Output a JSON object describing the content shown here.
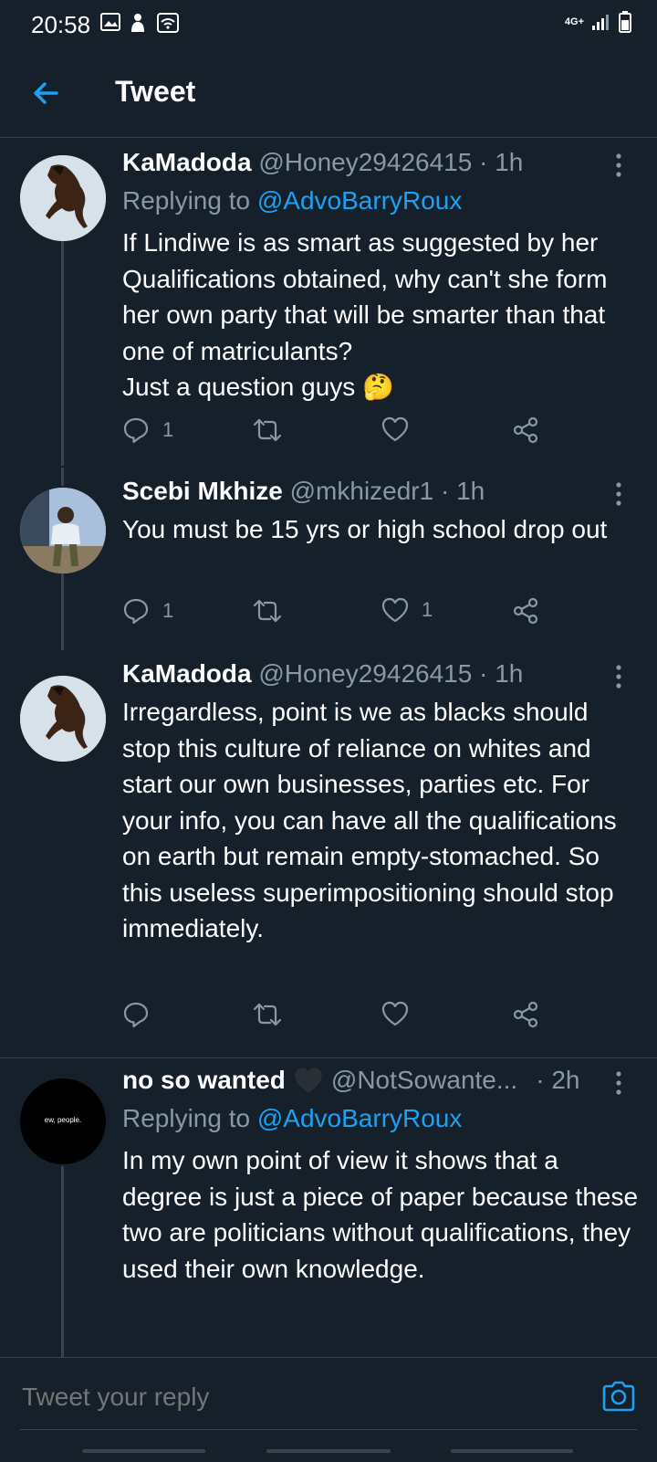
{
  "status": {
    "time": "20:58",
    "network": "4G+"
  },
  "header": {
    "title": "Tweet"
  },
  "tweets": [
    {
      "name": "KaMadoda",
      "handle": "@Honey29426415",
      "time": "· 1h",
      "reply_prefix": "Replying to ",
      "reply_to": "@AdvoBarryRoux",
      "text": "If Lindiwe is as smart as suggested by her Qualifications obtained, why can't she form her own party that will be smarter than that one of matriculants?\nJust a question guys 🤔",
      "replies": "1",
      "retweets": "",
      "likes": ""
    },
    {
      "name": "Scebi Mkhize",
      "handle": "@mkhizedr1",
      "time": "· 1h",
      "text": "You must be 15 yrs or high school drop out",
      "replies": "1",
      "retweets": "",
      "likes": "1"
    },
    {
      "name": "KaMadoda",
      "handle": "@Honey29426415",
      "time": "· 1h",
      "text": "Irregardless, point is we as blacks should stop this culture of reliance on whites and start our own businesses, parties etc. For your info, you can have all the qualifications on earth but remain empty-stomached. So this useless superimpositioning should stop immediately.",
      "replies": "",
      "retweets": "",
      "likes": ""
    },
    {
      "name": "no so wanted",
      "handle": "@NotSowante...",
      "time": "· 2h",
      "reply_prefix": "Replying to ",
      "reply_to": "@AdvoBarryRoux",
      "text": "In my own point of view it shows that a degree is just a piece of paper because these two are politicians without qualifications, they used their own knowledge.",
      "avatar_text": "ew, people."
    }
  ],
  "reply_bar": {
    "placeholder": "Tweet your reply"
  },
  "colors": {
    "background": "#15202b",
    "accent": "#1da1f2",
    "muted": "#8899a6",
    "divider": "#38444d"
  }
}
